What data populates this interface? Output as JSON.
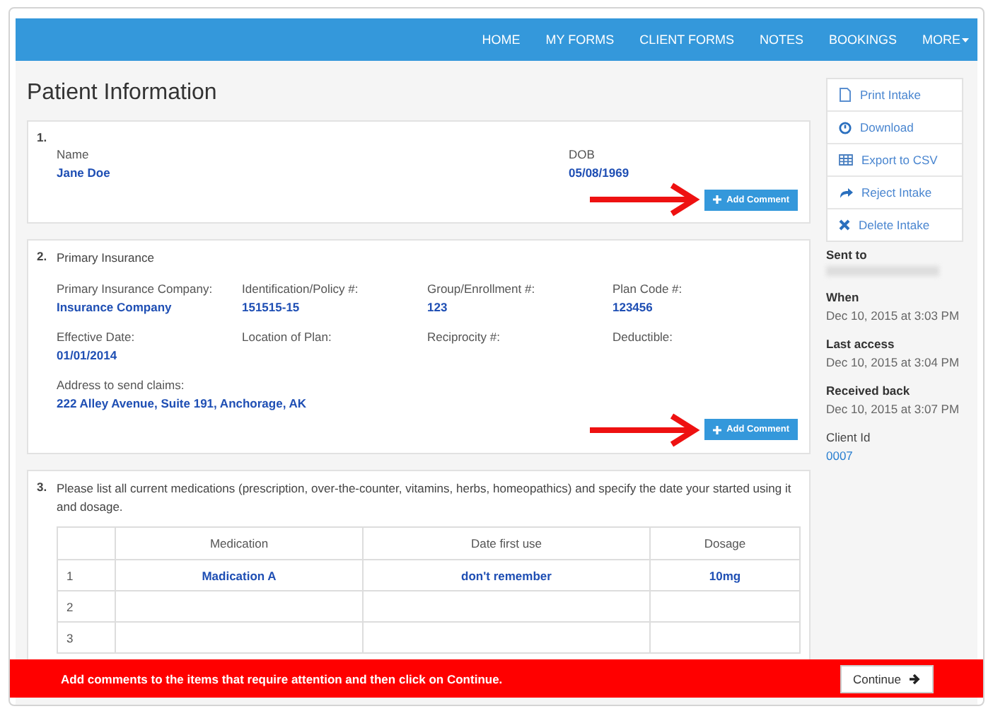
{
  "nav": [
    {
      "label": "HOME",
      "kind": "link"
    },
    {
      "label": "MY FORMS",
      "kind": "link"
    },
    {
      "label": "CLIENT FORMS",
      "kind": "link"
    },
    {
      "label": "NOTES",
      "kind": "link"
    },
    {
      "label": "BOOKINGS",
      "kind": "link"
    },
    {
      "label": "MORE",
      "kind": "dropdown"
    }
  ],
  "title": "Patient Information",
  "sections": [
    {
      "kind": "fields",
      "number": "1.",
      "rows": [
        [
          {
            "label": "Name",
            "value": "Jane Doe"
          },
          {
            "label": "DOB",
            "value": "05/08/1969"
          }
        ]
      ],
      "comment_button": "Add Comment"
    },
    {
      "kind": "fields",
      "number": "2.",
      "heading": "Primary Insurance",
      "rows": [
        [
          {
            "label": "Primary Insurance Company:",
            "value": "Insurance Company"
          },
          {
            "label": "Identification/Policy #:",
            "value": "151515-15"
          },
          {
            "label": "Group/Enrollment #:",
            "value": "123"
          },
          {
            "label": "Plan Code #:",
            "value": "123456"
          }
        ],
        [
          {
            "label": "Effective Date:",
            "value": "01/01/2014"
          },
          {
            "label": "Location of Plan:"
          },
          {
            "label": "Reciprocity #:"
          },
          {
            "label": "Deductible:"
          }
        ],
        [
          {
            "label": "Address to send claims:",
            "value": "222 Alley Avenue, Suite 191, Anchorage, AK"
          }
        ]
      ],
      "comment_button": "Add Comment"
    },
    {
      "kind": "table",
      "number": "3.",
      "heading": "Please list all current medications (prescription, over-the-counter, vitamins, herbs, homeopathics) and specify the date your started using it and dosage.",
      "table": {
        "columns": [
          "Medication",
          "Date first use",
          "Dosage"
        ],
        "rows": [
          {
            "index": "1",
            "cells": [
              "Madication A",
              "don't remember",
              "10mg"
            ]
          },
          {
            "index": "2",
            "cells": []
          },
          {
            "index": "3",
            "cells": []
          }
        ]
      }
    }
  ],
  "actions": [
    {
      "label": "Print Intake"
    },
    {
      "label": "Download"
    },
    {
      "label": "Export to CSV"
    },
    {
      "label": "Reject Intake"
    },
    {
      "label": "Delete Intake"
    }
  ],
  "info": [
    {
      "label": "Sent to",
      "kind": "redacted"
    },
    {
      "label": "When",
      "value": "Dec 10, 2015 at 3:03 PM",
      "kind": "bold"
    },
    {
      "label": "Last access",
      "value": "Dec 10, 2015 at 3:04 PM",
      "kind": "bold"
    },
    {
      "label": "Received back",
      "value": "Dec 10, 2015 at 3:07 PM",
      "kind": "bold"
    },
    {
      "label": "Client Id",
      "value": "0007",
      "kind": "link"
    }
  ],
  "footer": {
    "message": "Add comments to the items that require attention and then click on Continue.",
    "button": "Continue"
  }
}
